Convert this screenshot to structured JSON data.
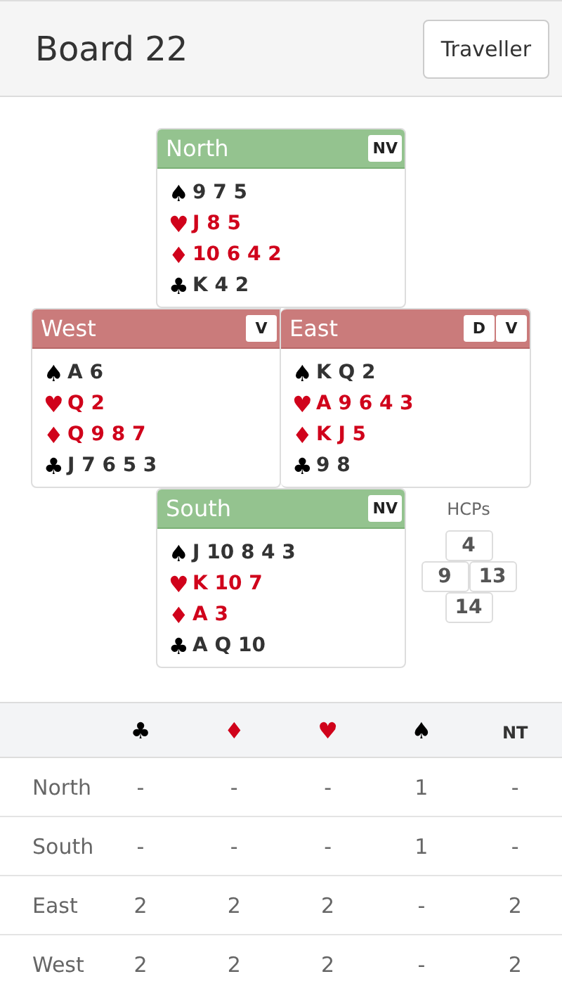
{
  "header": {
    "title": "Board 22",
    "button": "Traveller"
  },
  "hands": [
    {
      "kind": "north",
      "name": "North",
      "vulnerable": false,
      "badges": [
        "NV"
      ],
      "suits": [
        {
          "symbol": "♠",
          "kind": "black",
          "cards": "9 7 5"
        },
        {
          "symbol": "♥",
          "kind": "red",
          "cards": "J 8 5"
        },
        {
          "symbol": "♦",
          "kind": "red",
          "cards": "10 6 4 2"
        },
        {
          "symbol": "♣",
          "kind": "black",
          "cards": "K 4 2"
        }
      ]
    },
    {
      "kind": "west",
      "name": "West",
      "vulnerable": true,
      "badges": [
        "V"
      ],
      "suits": [
        {
          "symbol": "♠",
          "kind": "black",
          "cards": "A 6"
        },
        {
          "symbol": "♥",
          "kind": "red",
          "cards": "Q 2"
        },
        {
          "symbol": "♦",
          "kind": "red",
          "cards": "Q 9 8 7"
        },
        {
          "symbol": "♣",
          "kind": "black",
          "cards": "J 7 6 5 3"
        }
      ]
    },
    {
      "kind": "east",
      "name": "East",
      "vulnerable": true,
      "badges": [
        "D",
        "V"
      ],
      "suits": [
        {
          "symbol": "♠",
          "kind": "black",
          "cards": "K Q 2"
        },
        {
          "symbol": "♥",
          "kind": "red",
          "cards": "A 9 6 4 3"
        },
        {
          "symbol": "♦",
          "kind": "red",
          "cards": "K J 5"
        },
        {
          "symbol": "♣",
          "kind": "black",
          "cards": "9 8"
        }
      ]
    },
    {
      "kind": "south",
      "name": "South",
      "vulnerable": false,
      "badges": [
        "NV"
      ],
      "suits": [
        {
          "symbol": "♠",
          "kind": "black",
          "cards": "J 10 8 4 3"
        },
        {
          "symbol": "♥",
          "kind": "red",
          "cards": "K 10 7"
        },
        {
          "symbol": "♦",
          "kind": "red",
          "cards": "A 3"
        },
        {
          "symbol": "♣",
          "kind": "black",
          "cards": "A Q 10"
        }
      ]
    }
  ],
  "hcps": {
    "label": "HCPs",
    "north": "4",
    "west": "9",
    "east": "13",
    "south": "14"
  },
  "table": {
    "columns": [
      {
        "text": "♣",
        "kind": "black"
      },
      {
        "text": "♦",
        "kind": "red"
      },
      {
        "text": "♥",
        "kind": "red"
      },
      {
        "text": "♠",
        "kind": "black"
      },
      {
        "text": "NT",
        "kind": "plain"
      }
    ],
    "rows": [
      {
        "name": "North",
        "values": [
          "-",
          "-",
          "-",
          "1",
          "-"
        ]
      },
      {
        "name": "South",
        "values": [
          "-",
          "-",
          "-",
          "1",
          "-"
        ]
      },
      {
        "name": "East",
        "values": [
          "2",
          "2",
          "2",
          "-",
          "2"
        ]
      },
      {
        "name": "West",
        "values": [
          "2",
          "2",
          "2",
          "-",
          "2"
        ]
      }
    ]
  }
}
